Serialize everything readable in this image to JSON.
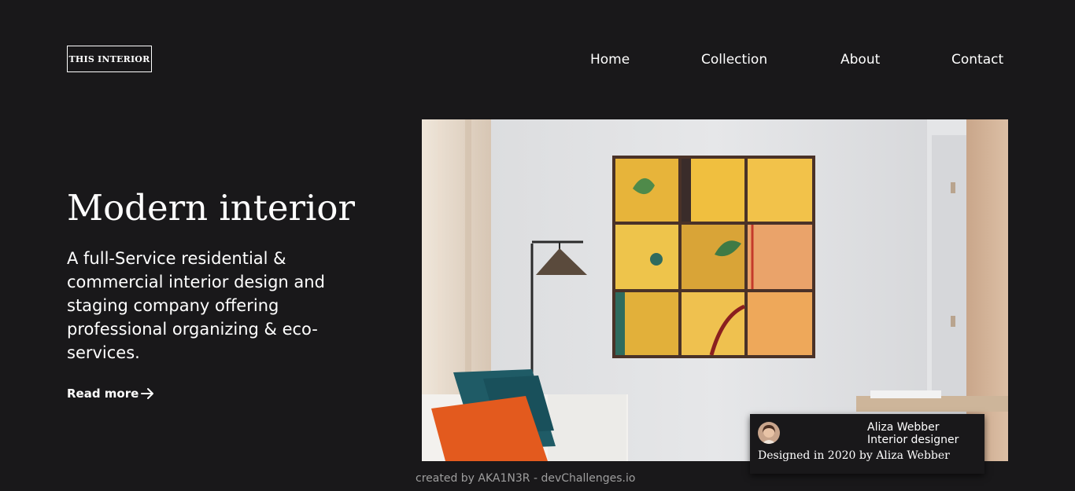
{
  "header": {
    "logo_text": "THIS INTERIOR",
    "nav": [
      {
        "label": "Home"
      },
      {
        "label": "Collection"
      },
      {
        "label": "About"
      },
      {
        "label": "Contact"
      }
    ]
  },
  "hero": {
    "title": "Modern interior",
    "description": "A full-Service residential & commercial interior design and staging company offering professional organizing & eco-services.",
    "read_more_label": "Read more",
    "read_more_icon": "arrow-right-icon"
  },
  "credit_card": {
    "name": "Aliza Webber",
    "role": "Interior designer",
    "note": "Designed in 2020 by Aliza Webber"
  },
  "footer": {
    "text": "created by AKA1N3R - devChallenges.io"
  },
  "colors": {
    "background": "#19181a",
    "text": "#ffffff",
    "footer_text": "#9e9e9e"
  }
}
